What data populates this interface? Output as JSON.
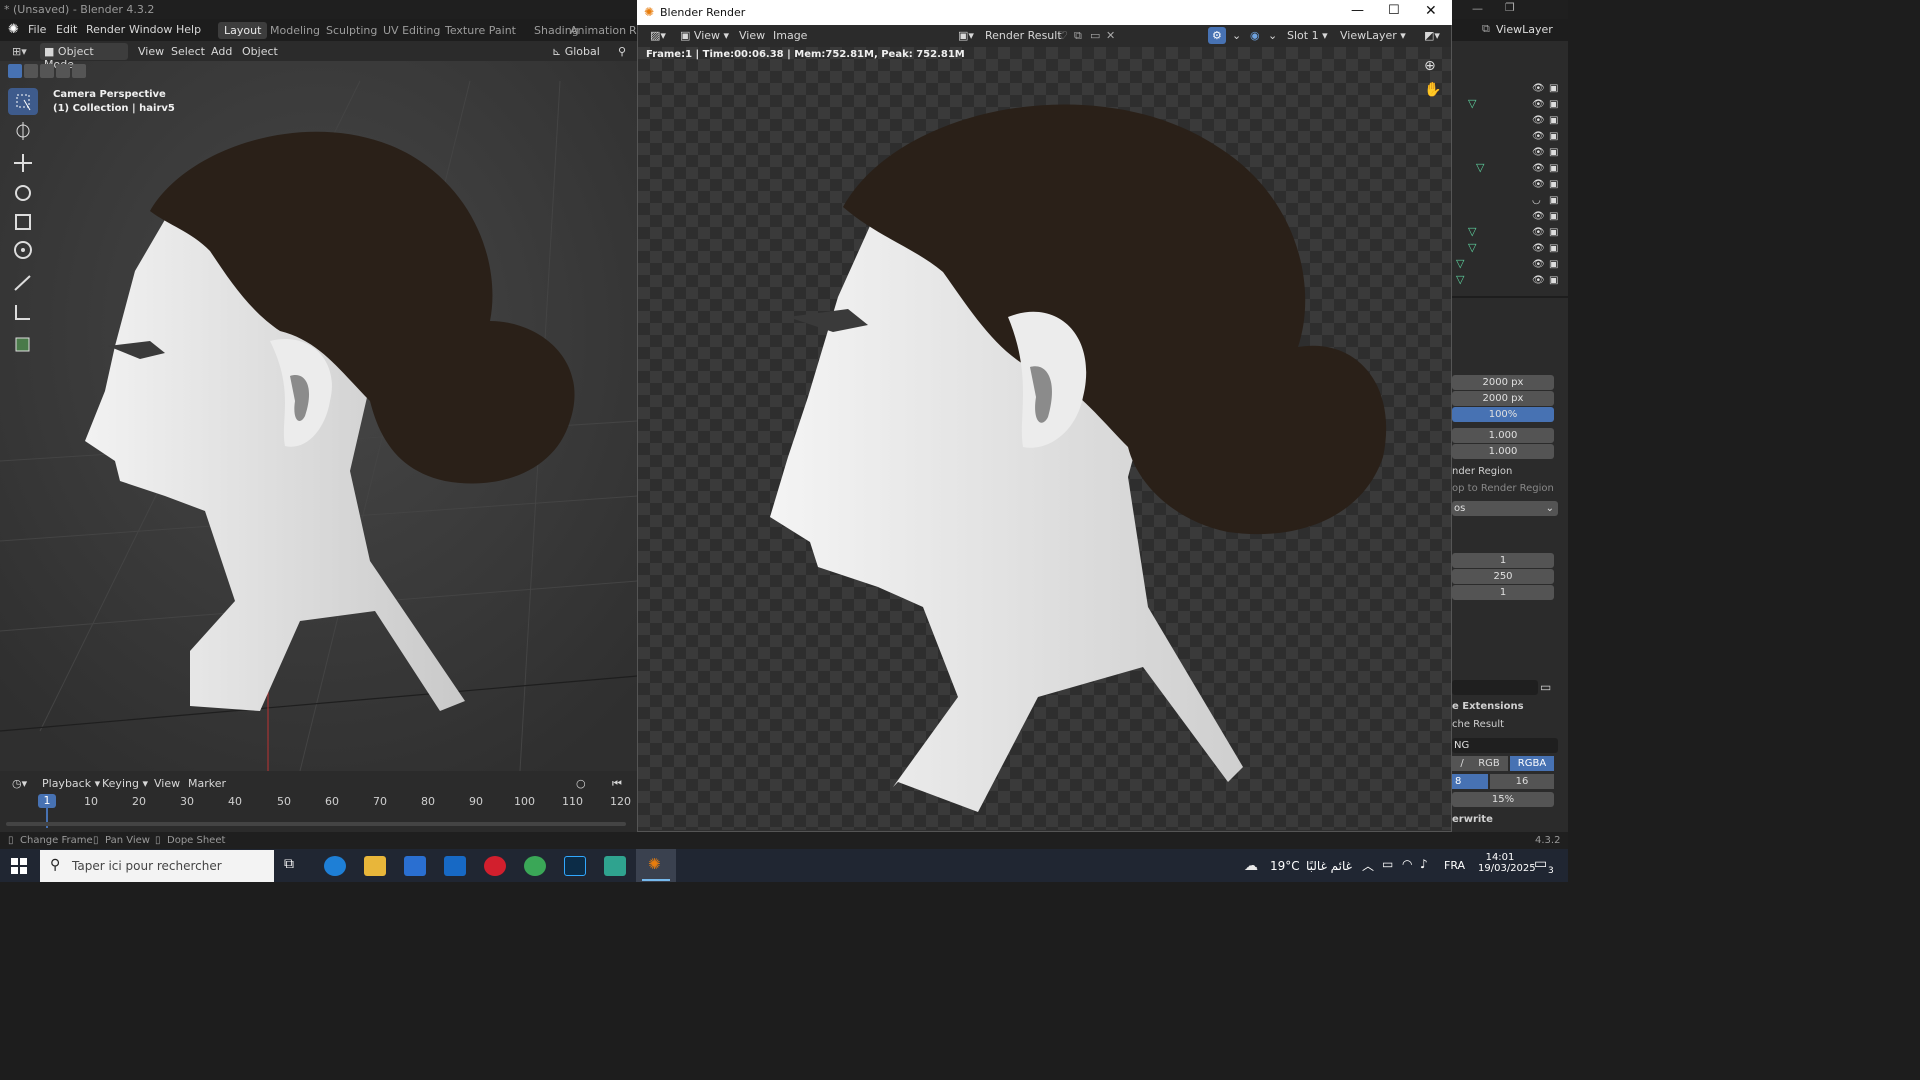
{
  "app": {
    "window_title": "* (Unsaved) - Blender 4.3.2",
    "menu": [
      "File",
      "Edit",
      "Render",
      "Window",
      "Help"
    ],
    "workspaces": [
      "Layout",
      "Modeling",
      "Sculpting",
      "UV Editing",
      "Texture Paint",
      "Shading",
      "Animation",
      "R"
    ],
    "active_workspace": "Layout"
  },
  "viewport": {
    "mode": "Object Mode",
    "header_menus": [
      "View",
      "Select",
      "Add",
      "Object"
    ],
    "orientation": "Global",
    "overlay_line1": "Camera Perspective",
    "overlay_line2": "(1) Collection | hairv5"
  },
  "timeline": {
    "menus": [
      "Playback",
      "Keying",
      "View",
      "Marker"
    ],
    "current_frame": "1",
    "frame_ticks": [
      "10",
      "20",
      "30",
      "40",
      "50",
      "60",
      "70",
      "80",
      "90",
      "100",
      "110",
      "120"
    ]
  },
  "status_bar": {
    "items": [
      "Change Frame",
      "Pan View",
      "Dope Sheet"
    ],
    "version": "4.3.2"
  },
  "render_window": {
    "title": "Blender Render",
    "menus": [
      "View",
      "View",
      "Image"
    ],
    "image_name": "Render Result",
    "slot": "Slot 1",
    "view_layer": "ViewLayer",
    "stats": "Frame:1 | Time:00:06.38 | Mem:752.81M, Peak: 752.81M"
  },
  "properties": {
    "view_layer_label": "ViewLayer",
    "resolution_x": "2000 px",
    "resolution_y": "2000 px",
    "resolution_pct": "100%",
    "aspect_x": "1.000",
    "aspect_y": "1.000",
    "render_region": "nder Region",
    "crop_region": "op to Render Region",
    "fps_suffix": "os",
    "frame_start": "1",
    "frame_end": "250",
    "frame_step": "1",
    "file_extensions": "e Extensions",
    "cache_result": "che Result",
    "format": "NG",
    "color_bw": "/",
    "color_rgb": "RGB",
    "color_rgba": "RGBA",
    "depth_8": "8",
    "depth_16": "16",
    "compression": "15%",
    "overwrite": "erwrite"
  },
  "taskbar": {
    "search_placeholder": "Taper ici pour rechercher",
    "weather": "19°C",
    "weather_text": "غائم غالبًا",
    "language": "FRA",
    "time": "14:01",
    "date": "19/03/2025",
    "notifications": "3"
  }
}
